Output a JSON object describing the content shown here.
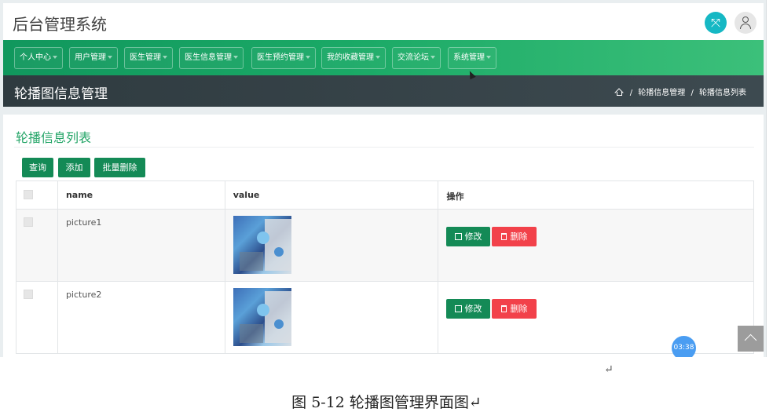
{
  "header": {
    "system_title": "后台管理系统"
  },
  "nav": {
    "items": [
      {
        "label": "个人中心"
      },
      {
        "label": "用户管理"
      },
      {
        "label": "医生管理"
      },
      {
        "label": "医生信息管理"
      },
      {
        "label": "医生预约管理"
      },
      {
        "label": "我的收藏管理"
      },
      {
        "label": "交流论坛"
      },
      {
        "label": "系统管理"
      }
    ]
  },
  "page": {
    "title": "轮播图信息管理",
    "breadcrumb": {
      "level1": "轮播信息管理",
      "sep": "/",
      "level2": "轮播信息列表"
    }
  },
  "card": {
    "title": "轮播信息列表",
    "buttons": {
      "query": "查询",
      "add": "添加",
      "batch_delete": "批量删除"
    }
  },
  "table": {
    "headers": {
      "name": "name",
      "value": "value",
      "actions": "操作"
    },
    "rows": [
      {
        "name": "picture1",
        "edit": "修改",
        "delete": "删除"
      },
      {
        "name": "picture2",
        "edit": "修改",
        "delete": "删除"
      }
    ]
  },
  "timer": {
    "text": "03:38"
  },
  "figure": {
    "return_mark": "↵",
    "caption": "图 5-12 轮播图管理界面图↵"
  },
  "colors": {
    "primary_green": "#148a56",
    "danger_red": "#f2414a",
    "accent_cyan": "#16b8c4",
    "title_green": "#22a466"
  },
  "icons": {
    "fullscreen": "fullscreen-icon",
    "user": "user-icon",
    "home": "home-icon",
    "edit": "edit-icon",
    "delete": "trash-icon",
    "back_to_top": "chevron-up-icon"
  }
}
